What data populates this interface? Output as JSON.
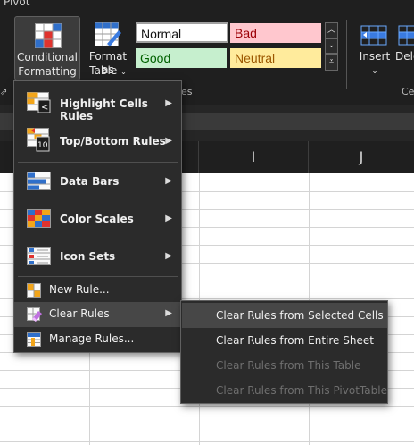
{
  "ribbon": {
    "pivot_tab": "Pivot",
    "conditional_formatting": {
      "line1": "Conditional",
      "line2": "Formatting"
    },
    "format_as_table": {
      "line1": "Format as",
      "line2": "Table"
    },
    "cell_styles": {
      "normal": "Normal",
      "bad": "Bad",
      "good": "Good",
      "neutral": "Neutral"
    },
    "styles_group_label": "es",
    "insert": {
      "label": "Insert"
    },
    "delete": {
      "label": "Dele"
    },
    "cells_group_label": "Cel",
    "left_group_mark": "⇗"
  },
  "columns": [
    "I",
    "J"
  ],
  "menu": {
    "items": [
      {
        "label": "Highlight Cells Rules",
        "icon": "highlight-cells-icon",
        "has_submenu": true
      },
      {
        "label": "Top/Bottom Rules",
        "icon": "top-bottom-icon",
        "has_submenu": true
      },
      {
        "label": "Data Bars",
        "icon": "data-bars-icon",
        "has_submenu": true
      },
      {
        "label": "Color Scales",
        "icon": "color-scales-icon",
        "has_submenu": true
      },
      {
        "label": "Icon Sets",
        "icon": "icon-sets-icon",
        "has_submenu": true
      },
      {
        "label": "New Rule...",
        "icon": "new-rule-icon",
        "has_submenu": false
      },
      {
        "label": "Clear Rules",
        "icon": "clear-rules-icon",
        "has_submenu": true,
        "active": true
      },
      {
        "label": "Manage Rules...",
        "icon": "manage-rules-icon",
        "has_submenu": false
      }
    ]
  },
  "submenu": {
    "items": [
      {
        "label": "Clear Rules from Selected Cells",
        "enabled": true,
        "hover": true
      },
      {
        "label": "Clear Rules from Entire Sheet",
        "enabled": true
      },
      {
        "label": "Clear Rules from This Table",
        "enabled": false
      },
      {
        "label": "Clear Rules from This PivotTable",
        "enabled": false
      }
    ]
  },
  "colors": {
    "ribbon_bg": "#1f1f1f",
    "menu_bg": "#2b2b2b",
    "menu_active": "#474747",
    "bad_bg": "#ffc7ce",
    "bad_fg": "#9c0006",
    "good_bg": "#c6efce",
    "good_fg": "#006100",
    "neutral_bg": "#ffeb9c",
    "neutral_fg": "#9c5700"
  }
}
